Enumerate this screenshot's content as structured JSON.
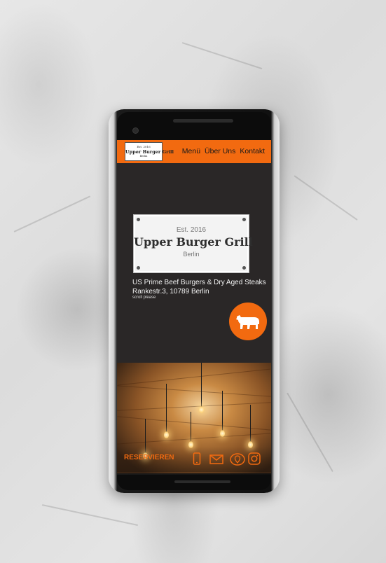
{
  "nav": {
    "logo": {
      "est": "Est. 2016",
      "name": "Upper Burger Grill",
      "city": "Berlin"
    },
    "links": [
      "Menü",
      "Über Uns",
      "Kontakt"
    ]
  },
  "hero": {
    "sign": {
      "est": "Est. 2016",
      "title": "Upper Burger Grill",
      "city": "Berlin"
    },
    "tagline_line1": "US Prime Beef Burgers & Dry Aged Steaks",
    "tagline_line2": "Rankestr.3, 10789 Berlin",
    "scroll_hint": "scroll please",
    "fab_icon": "bull-icon"
  },
  "bottom_bar": {
    "reserve_label": "RESERVIEREN",
    "icons": [
      "phone-icon",
      "mail-icon",
      "map-icon",
      "instagram-icon"
    ]
  },
  "colors": {
    "accent": "#f26a10",
    "background": "#2a2727",
    "text": "#f2f2f2"
  }
}
